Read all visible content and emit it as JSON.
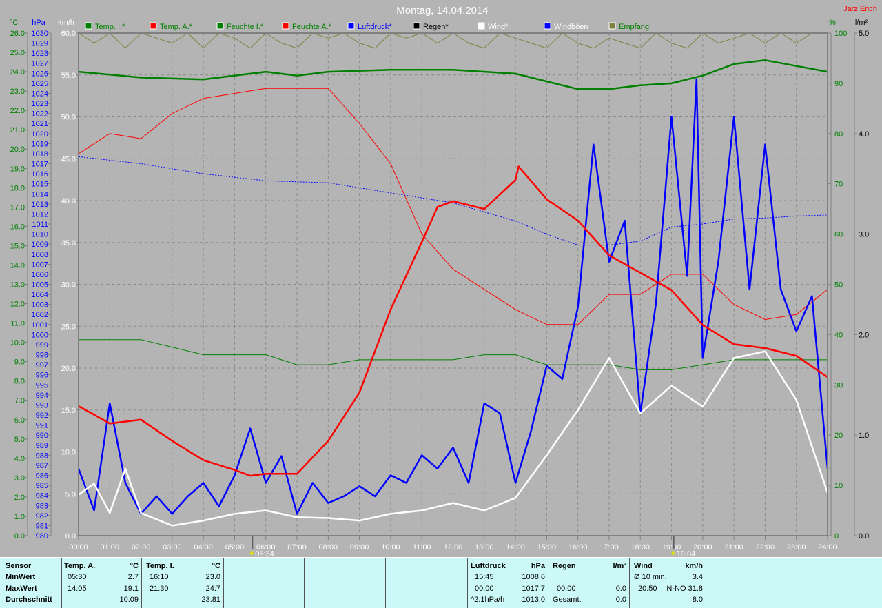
{
  "title": "Montag, 14.04.2014",
  "author": "Jarz Erich",
  "legend": [
    {
      "label": "Temp. I.*",
      "color": "#008000",
      "text_color": "#008000"
    },
    {
      "label": "Temp. A.*",
      "color": "#ff0000",
      "text_color": "#008000"
    },
    {
      "label": "Feuchte I.*",
      "color": "#008000",
      "text_color": "#008000"
    },
    {
      "label": "Feuchte A.*",
      "color": "#ff0000",
      "text_color": "#008000"
    },
    {
      "label": "Luftdruck*",
      "color": "#0000ff",
      "text_color": "#0000ff"
    },
    {
      "label": "Regen*",
      "color": "#000000",
      "text_color": "#000000"
    },
    {
      "label": "Wind*",
      "color": "#ffffff",
      "text_color": "#ffffff"
    },
    {
      "label": "Windböen",
      "color": "#0000ff",
      "text_color": "#ffffff"
    },
    {
      "label": "Empfang",
      "color": "#808040",
      "text_color": "#008000"
    }
  ],
  "chart_data": {
    "type": "line",
    "title": "Montag, 14.04.2014",
    "x_unit": "hours",
    "xlim": [
      0,
      24
    ],
    "x_tick_labels": [
      "00:00",
      "01:00",
      "02:00",
      "03:00",
      "04:00",
      "05:00",
      "06:00",
      "07:00",
      "08:00",
      "09:00",
      "10:00",
      "11:00",
      "12:00",
      "13:00",
      "14:00",
      "15:00",
      "16:00",
      "17:00",
      "18:00",
      "19:00",
      "20:00",
      "21:00",
      "22:00",
      "23:00",
      "24:00"
    ],
    "axes": {
      "celsius": {
        "unit": "°C",
        "min": 0,
        "max": 26,
        "step": 1,
        "decimals": 1,
        "color": "#008000"
      },
      "hpa": {
        "unit": "hPa",
        "min": 980,
        "max": 1030,
        "step": 1,
        "decimals": 0,
        "color": "#0000ff"
      },
      "kmh": {
        "unit": "km/h",
        "min": 0,
        "max": 60,
        "step": 5,
        "decimals": 1,
        "color": "#ffffff"
      },
      "percent": {
        "unit": "%",
        "min": 0,
        "max": 100,
        "step": 10,
        "decimals": 0,
        "color": "#008000"
      },
      "rain": {
        "unit": "l/m²",
        "min": 0,
        "max": 5,
        "step": 1,
        "decimals": 1,
        "color": "#000000"
      }
    },
    "grid": true,
    "markers": [
      {
        "label": "05:34",
        "x": 5.57,
        "kind": "sunrise"
      },
      {
        "label": "19:04",
        "x": 19.07,
        "kind": "sunset"
      }
    ],
    "series": [
      {
        "name": "Empfang",
        "axis": "percent",
        "color": "#808040",
        "width": 1,
        "x": [
          0,
          0.5,
          1,
          1.5,
          2,
          2.5,
          3,
          3.5,
          4,
          4.5,
          5,
          5.5,
          6,
          6.5,
          7,
          7.5,
          8,
          8.5,
          9,
          9.5,
          10,
          10.5,
          11,
          11.5,
          12,
          12.5,
          13,
          13.5,
          14,
          14.5,
          15,
          15.5,
          16,
          16.5,
          17,
          17.5,
          18,
          18.5,
          19,
          19.5,
          20,
          20.5,
          21,
          21.5,
          22,
          22.5,
          23,
          23.5,
          24
        ],
        "y": [
          100,
          98,
          100,
          97,
          100,
          99,
          98,
          100,
          97,
          100,
          99,
          97,
          100,
          98,
          97,
          100,
          99,
          100,
          98,
          97,
          100,
          99,
          100,
          98,
          100,
          98,
          97,
          100,
          99,
          98,
          97,
          100,
          98,
          97,
          99,
          98,
          97,
          100,
          98,
          97,
          100,
          98,
          99,
          100,
          98,
          100,
          98,
          100,
          100
        ]
      },
      {
        "name": "Feuchte I.",
        "axis": "percent",
        "color": "#008000",
        "width": 1,
        "x": [
          0,
          2,
          4,
          5,
          6,
          7,
          8,
          9,
          10,
          12,
          13,
          14,
          15,
          16,
          17,
          18,
          19,
          20,
          21,
          22,
          23,
          24
        ],
        "y": [
          39,
          39,
          36,
          36,
          36,
          34,
          34,
          35,
          35,
          35,
          36,
          36,
          34,
          34,
          34,
          33,
          33,
          34,
          35,
          35,
          35,
          35
        ]
      },
      {
        "name": "Feuchte A.",
        "axis": "percent",
        "color": "#ff0000",
        "width": 1,
        "x": [
          0,
          1,
          2,
          3,
          4,
          5,
          6,
          7,
          8,
          9,
          10,
          11,
          12,
          13,
          14,
          15,
          16,
          17,
          18,
          19,
          20,
          21,
          22,
          23,
          24
        ],
        "y": [
          76,
          80,
          79,
          84,
          87,
          88,
          89,
          89,
          89,
          82,
          74,
          60,
          53,
          49,
          45,
          42,
          42,
          48,
          48,
          52,
          52,
          46,
          43,
          44,
          49
        ]
      },
      {
        "name": "Luftdruck",
        "axis": "hpa",
        "color": "#0000ff",
        "width": 1,
        "dash": "2,2",
        "x": [
          0,
          2,
          4,
          6,
          8,
          10,
          12,
          14,
          15,
          16,
          17,
          18,
          19,
          20,
          21,
          22,
          23,
          24
        ],
        "y": [
          1017.7,
          1017.0,
          1016.0,
          1015.3,
          1015.1,
          1014.1,
          1013.1,
          1011.3,
          1010.0,
          1008.9,
          1008.9,
          1009.3,
          1010.7,
          1011.0,
          1011.5,
          1011.6,
          1011.8,
          1011.9
        ]
      },
      {
        "name": "Temp. I.",
        "axis": "celsius",
        "color": "#008000",
        "width": 2.5,
        "x": [
          0,
          2,
          4,
          6,
          7,
          8,
          10,
          12,
          14,
          15,
          16,
          17,
          18,
          19,
          20,
          21,
          22,
          23,
          24
        ],
        "y": [
          24.0,
          23.7,
          23.6,
          24.0,
          23.8,
          24.0,
          24.1,
          24.1,
          23.9,
          23.5,
          23.1,
          23.1,
          23.3,
          23.4,
          23.8,
          24.4,
          24.6,
          24.3,
          24.0
        ]
      },
      {
        "name": "Windböen",
        "axis": "kmh",
        "color": "#0000ff",
        "width": 2.5,
        "x": [
          0,
          0.5,
          1,
          1.5,
          2,
          2.5,
          3,
          3.5,
          4,
          4.5,
          5,
          5.5,
          6,
          6.5,
          7,
          7.5,
          8,
          8.5,
          9,
          9.5,
          10,
          10.5,
          11,
          11.5,
          12,
          12.5,
          13,
          13.5,
          14,
          14.5,
          15,
          15.5,
          16,
          16.5,
          17,
          17.5,
          18,
          18.5,
          19,
          19.5,
          19.8,
          20,
          20.5,
          21,
          21.5,
          22,
          22.5,
          23,
          23.5,
          24
        ],
        "y": [
          8,
          3,
          15.8,
          6.3,
          2.6,
          4.7,
          2.6,
          4.7,
          6.3,
          3.5,
          7.2,
          12.8,
          6.3,
          9.5,
          2.6,
          6.3,
          3.9,
          4.7,
          5.9,
          4.7,
          7.2,
          6.3,
          9.6,
          8,
          10.5,
          6.3,
          15.8,
          14.6,
          6.3,
          12.5,
          20.3,
          18.7,
          27.3,
          46.7,
          32.7,
          37.6,
          14.6,
          27.7,
          50,
          31,
          54.5,
          21.2,
          32.7,
          50,
          29.4,
          46.7,
          29.4,
          24.4,
          28.6,
          8
        ]
      },
      {
        "name": "Wind",
        "axis": "kmh",
        "color": "#ffffff",
        "width": 2.5,
        "x": [
          0,
          0.5,
          1,
          1.5,
          2,
          3,
          4,
          5,
          6,
          7,
          8,
          9,
          10,
          11,
          12,
          13,
          14,
          15,
          16,
          17,
          18,
          19,
          20,
          21,
          22,
          23,
          24
        ],
        "y": [
          4.9,
          6.2,
          2.7,
          8,
          2.7,
          1.2,
          1.8,
          2.6,
          3.0,
          2.2,
          2.1,
          1.8,
          2.6,
          3.0,
          3.9,
          3.0,
          4.5,
          9.6,
          15.0,
          21.2,
          14.6,
          17.9,
          15.4,
          21.2,
          22.0,
          16.2,
          5.1
        ]
      },
      {
        "name": "Temp. A.",
        "axis": "celsius",
        "color": "#ff0000",
        "width": 2.5,
        "x": [
          0,
          1,
          2,
          3,
          4,
          5,
          5.5,
          6,
          7,
          8,
          9,
          10,
          11,
          11.5,
          12,
          13,
          14,
          14.1,
          15,
          16,
          17,
          18,
          19,
          20,
          21,
          22,
          23,
          24
        ],
        "y": [
          6.7,
          5.8,
          6.0,
          4.9,
          3.9,
          3.4,
          3.1,
          3.2,
          3.2,
          4.9,
          7.4,
          11.7,
          15.2,
          17.0,
          17.3,
          16.9,
          18.4,
          19.1,
          17.4,
          16.3,
          14.5,
          13.6,
          12.7,
          10.9,
          9.9,
          9.7,
          9.3,
          8.2
        ]
      }
    ]
  },
  "stats": {
    "labels": {
      "sensor": "Sensor",
      "min": "MinWert",
      "max": "MaxWert",
      "avg": "Durchschnitt"
    },
    "temp_a": {
      "title": "Temp. A.",
      "unit": "°C",
      "min_time": "05:30",
      "min": "2.7",
      "max_time": "14:05",
      "max": "19.1",
      "avg": "10.09"
    },
    "temp_i": {
      "title": "Temp. I.",
      "unit": "°C",
      "min_time": "16:10",
      "min": "23.0",
      "max_time": "21:30",
      "max": "24.7",
      "avg": "23.81"
    },
    "pressure": {
      "title": "Luftdruck",
      "unit": "hPa",
      "min_time": "15:45",
      "min": "1008.6",
      "max_time": "00:00",
      "max": "1017.7",
      "trend": "^2.1hPa/h",
      "avg": "1013.0"
    },
    "rain": {
      "title": "Regen",
      "unit": "l/m²",
      "max_time": "00:00",
      "max": "0.0",
      "total_label": "Gesamt:",
      "total": "0.0"
    },
    "wind": {
      "title": "Wind",
      "unit": "km/h",
      "avg10_label": "Ø 10 min.",
      "avg10": "3.4",
      "max_time": "20:50",
      "max": "N-NO 31.8",
      "avg": "8.0"
    }
  }
}
